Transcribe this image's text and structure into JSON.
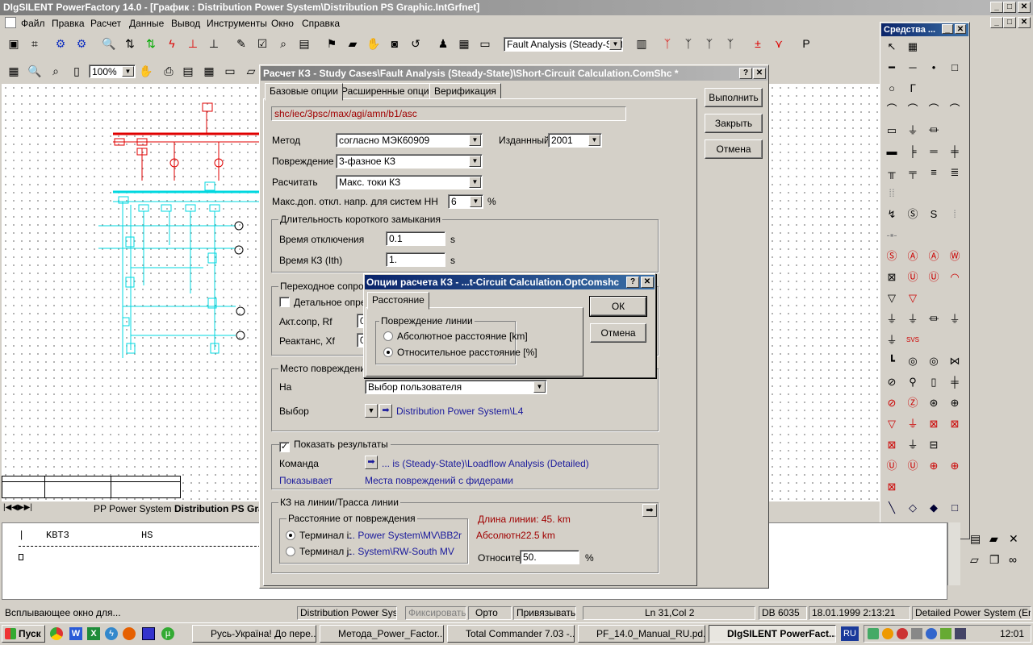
{
  "app": {
    "title": "DIgSILENT PowerFactory 14.0 - [График : Distribution Power System\\Distribution PS Graphic.IntGrfnet]"
  },
  "menu": [
    "Файл",
    "Правка",
    "Расчет",
    "Данные",
    "Вывод",
    "Инструменты",
    "Окно",
    "Справка"
  ],
  "toolbar": {
    "study_case": "Fault Analysis (Steady-Stat",
    "zoom": "100%"
  },
  "palette": {
    "title": "Средства ..."
  },
  "graphic_tabs": [
    "PP Power System",
    "Distribution PS Gra"
  ],
  "output": {
    "col1": "|",
    "col2": "KBT3",
    "col3": "HS"
  },
  "dialog": {
    "title": "Расчет КЗ - Study Cases\\Fault Analysis (Steady-State)\\Short-Circuit Calculation.ComShc *",
    "tabs": [
      "Базовые опции",
      "Расширенные опции",
      "Верификация"
    ],
    "path": "shc/iec/3psc/max/agi/amn/b1/asc",
    "method_label": "Метод",
    "method_value": "согласно МЭК60909",
    "edition_label": "Изданнный",
    "edition_value": "2001",
    "fault_label": "Повреждение",
    "fault_value": "3-фазное КЗ",
    "calc_label": "Расчитать",
    "calc_value": "Макс. токи КЗ",
    "volt_label": "Макс.доп. откл. напр. для систем НН",
    "volt_value": "6",
    "volt_unit": "%",
    "duration": {
      "title": "Длительность короткого замыкания",
      "trip_label": "Время отключения",
      "trip_value": "0.1",
      "unit": "s",
      "sc_label": "Время КЗ (Ith)",
      "sc_value": "1."
    },
    "transition": {
      "title": "Переходное сопроти",
      "detailed_label": "Детальное опред",
      "r_label": "Акт.сопр, Rf",
      "x_label": "Реактанс, Xf",
      "r_value": "0",
      "x_value": "0"
    },
    "fault_place": {
      "title": "Место повреждения",
      "at_label": "На",
      "at_value": "Выбор пользователя",
      "sel_label": "Выбор",
      "sel_value": "Distribution Power System\\L4"
    },
    "results": {
      "show_label": "Показать результаты",
      "cmd_label": "Команда",
      "cmd_value": "... is (Steady-State)\\Loadflow Analysis (Detailed)",
      "shows_label": "Показывает",
      "shows_value": "Места повреждений с фидерами"
    },
    "line_fault": {
      "title": "КЗ на линии/Трасса линии",
      "dist_title": "Расстояние от повреждения",
      "term_i": "Терминал i:",
      "term_i_val": "... Power System\\MV\\BB2r",
      "term_j": "Терминал j:",
      "term_j_val": "... System\\RW-South MV",
      "length": "Длина линии: 45. km",
      "absolute": "Абсолютн22.5 km",
      "rel_label": "Относите",
      "rel_value": "50.",
      "rel_unit": "%"
    },
    "buttons": {
      "execute": "Выполнить",
      "close": "Закрыть",
      "cancel": "Отмена"
    }
  },
  "subdialog": {
    "title": "Опции расчета КЗ - ...t-Circuit Calculation.OptComshc",
    "tab": "Расстояние",
    "group": "Повреждение линии",
    "opt1": "Абсолютное расстояние [km]",
    "opt2": "Относительное расстояние [%]",
    "ok": "ОК",
    "cancel": "Отмена"
  },
  "statusbar": [
    "Всплывающее окно для...",
    "Distribution Power System",
    "Фиксировать",
    "Орто",
    "Привязывать",
    "Ln 31,Col 2",
    "DB 6035",
    "18.01.1999 2:13:21",
    "Detailed Power System (English)"
  ],
  "taskbar": {
    "start": "Пуск",
    "tasks": [
      "Русь-Україна! До пере...",
      "Метода_Power_Factor...",
      "Total Commander 7.03 -...",
      "PF_14.0_Manual_RU.pd...",
      "DIgSILENT PowerFact..."
    ],
    "lang": "RU",
    "clock": "12:01"
  },
  "colors": {
    "active_title": "#0a246a",
    "cyan": "#00e0e0",
    "red": "#e00000",
    "face": "#d4d0c8"
  }
}
